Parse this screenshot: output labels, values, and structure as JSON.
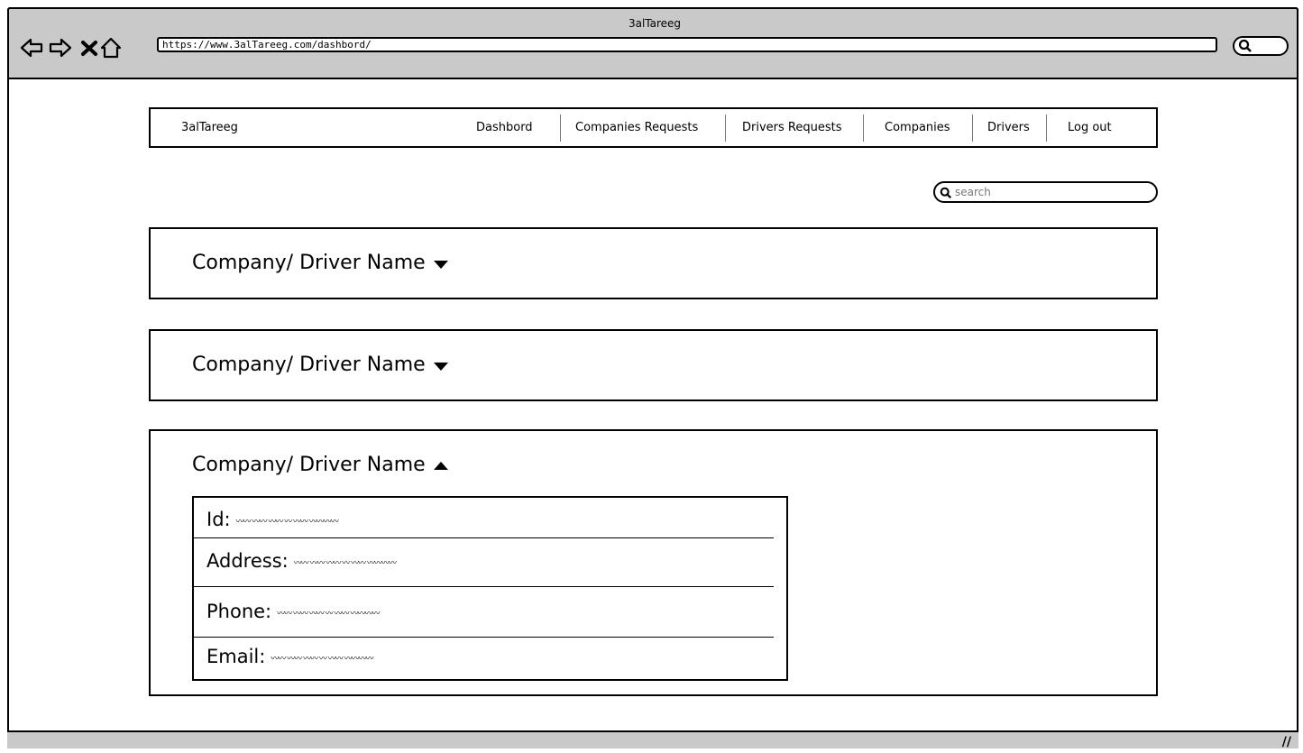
{
  "browser": {
    "title": "3alTareeg",
    "url": "https://www.3alTareeg.com/dashbord/"
  },
  "nav": {
    "brand": "3alTareeg",
    "items": [
      "Dashbord",
      "Companies Requests",
      "Drivers Requests",
      "Companies",
      "Drivers",
      "Log out"
    ]
  },
  "search": {
    "placeholder": "search"
  },
  "panels": [
    {
      "title": "Company/ Driver Name",
      "expanded": false
    },
    {
      "title": "Company/ Driver Name",
      "expanded": false
    },
    {
      "title": "Company/ Driver Name",
      "expanded": true
    }
  ],
  "details": {
    "id_label": "Id:",
    "address_label": "Address:",
    "phone_label": "Phone:",
    "email_label": "Email:"
  },
  "icons": [
    "back-arrow-icon",
    "forward-arrow-icon",
    "close-icon",
    "home-icon",
    "search-icon",
    "caret-down-icon",
    "caret-up-icon",
    "resize-grip-icon"
  ]
}
